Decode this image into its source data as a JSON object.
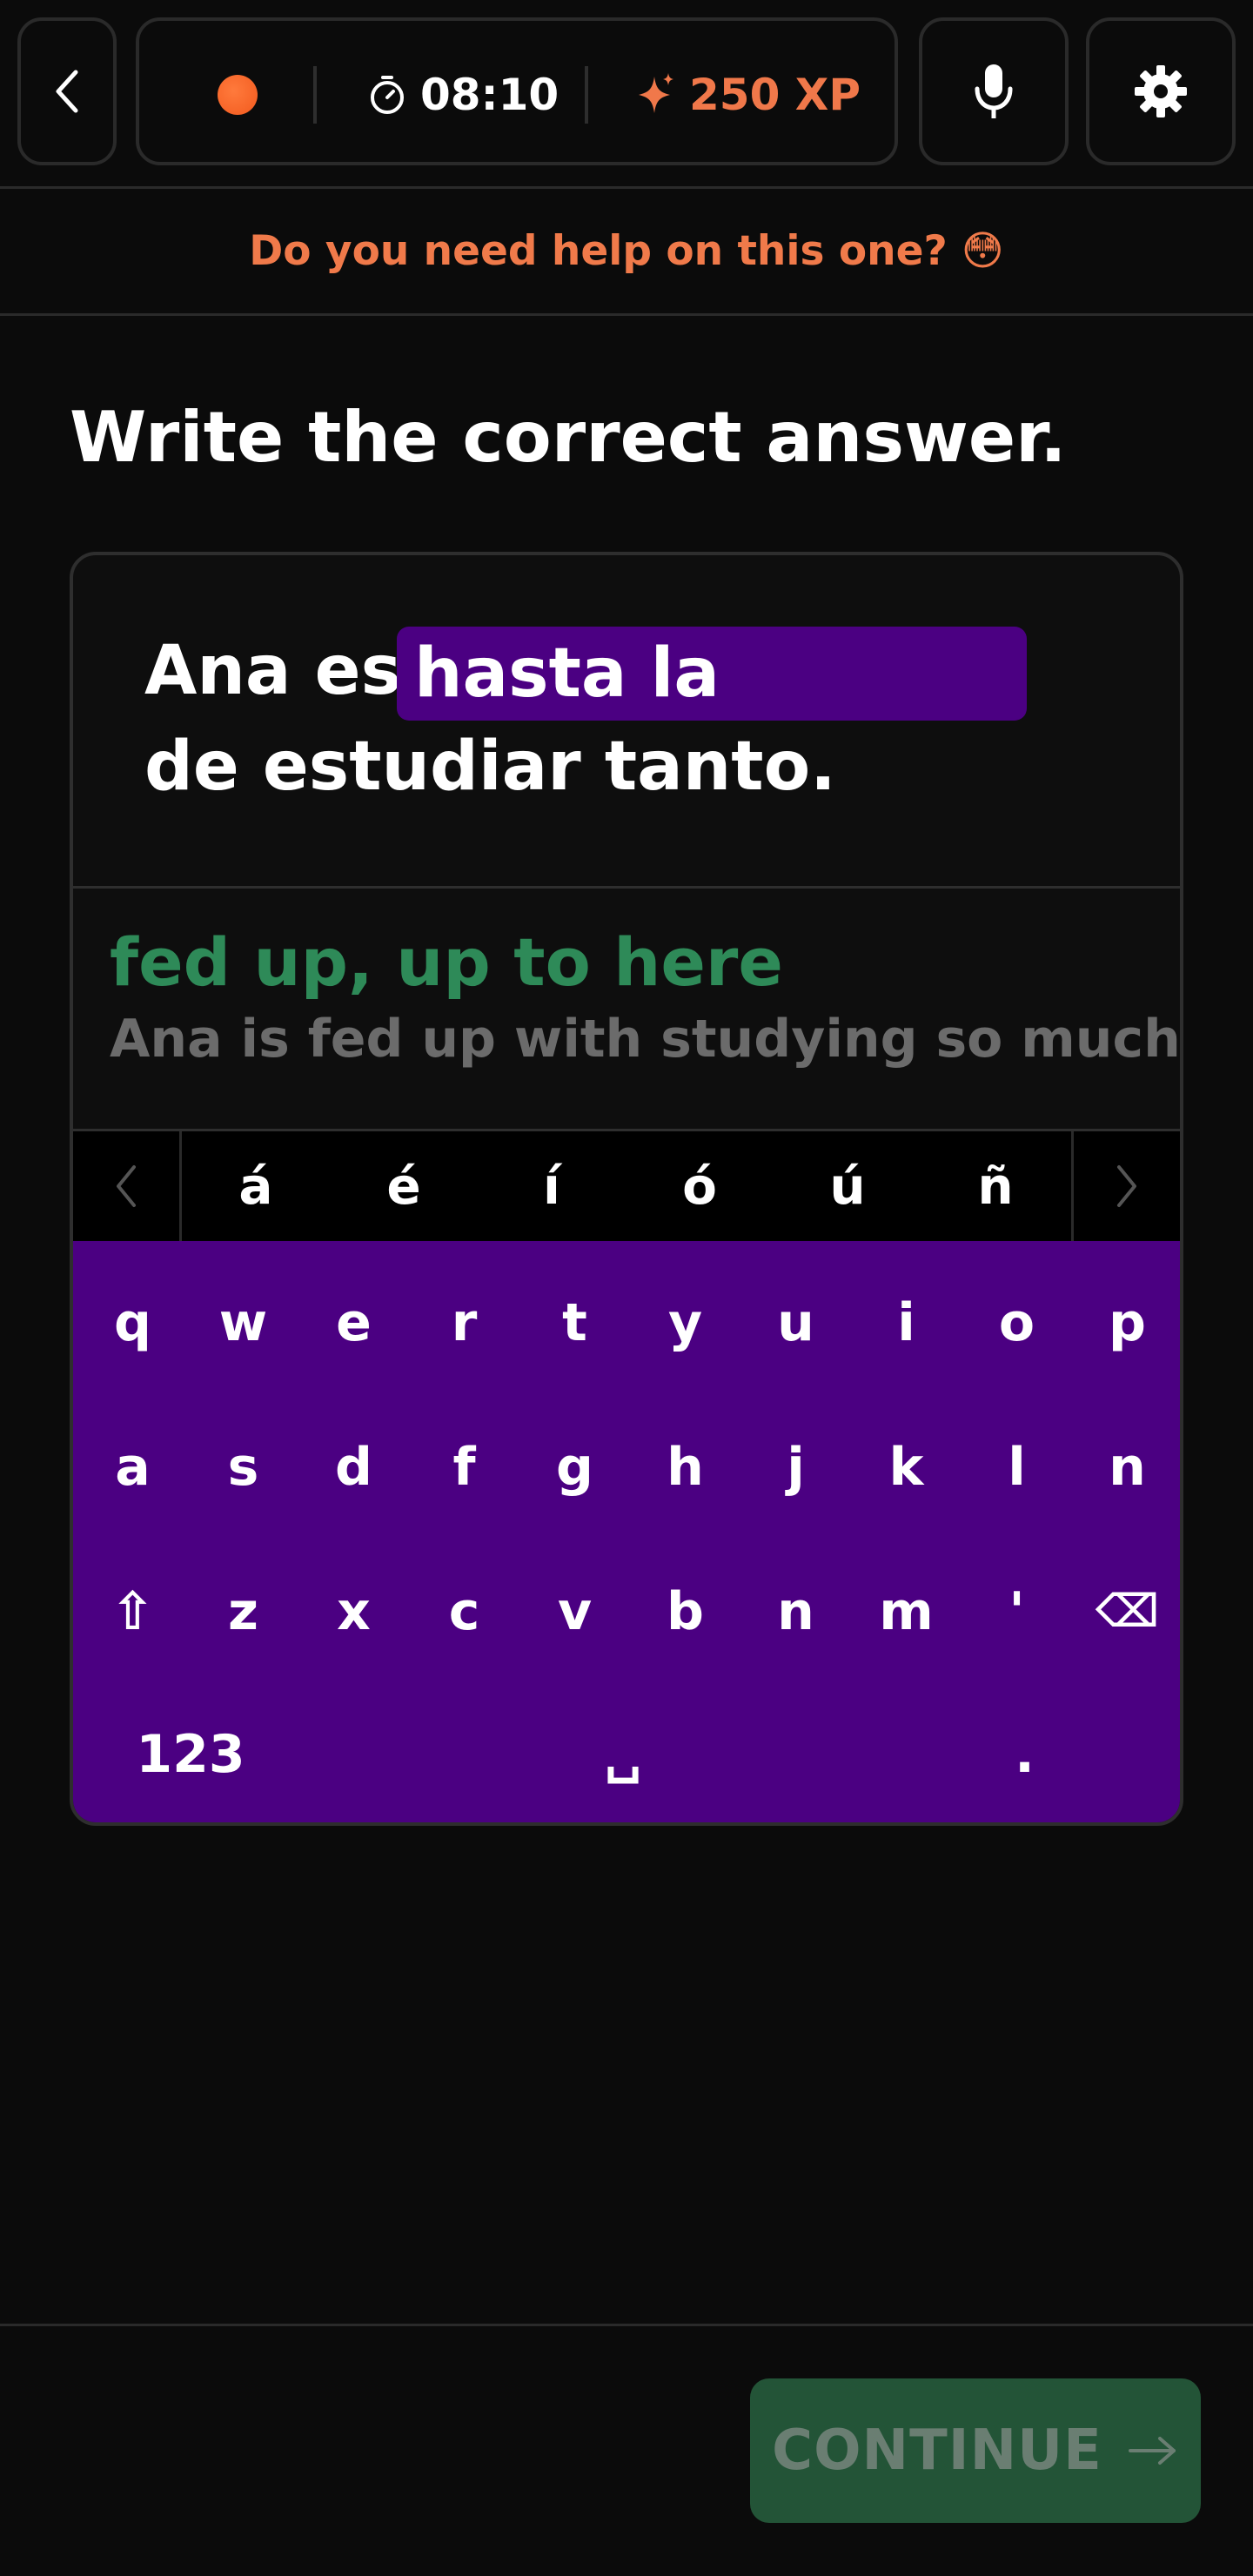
{
  "header": {
    "timer": "08:10",
    "xp": "250 XP",
    "icons": [
      "back-chevron-icon",
      "status-dot-icon",
      "stopwatch-icon",
      "sparkle-icon",
      "microphone-icon",
      "gear-icon"
    ],
    "status_color": "#f25a1e"
  },
  "help_text": "Do you need help on this one?",
  "help_emoji": "😳",
  "prompt": "Write the correct answer.",
  "exercise": {
    "before": "Ana está",
    "answer": "hasta la",
    "after": "de estudiar tanto."
  },
  "hint": {
    "meaning": "fed up, up to here",
    "translation": "Ana is fed up with studying so much."
  },
  "accents": [
    "á",
    "é",
    "í",
    "ó",
    "ú",
    "ñ"
  ],
  "keyboard": {
    "row1": [
      "q",
      "w",
      "e",
      "r",
      "t",
      "y",
      "u",
      "i",
      "o",
      "p"
    ],
    "row2": [
      "a",
      "s",
      "d",
      "f",
      "g",
      "h",
      "j",
      "k",
      "l",
      "n"
    ],
    "row3": [
      "⇧",
      "z",
      "x",
      "c",
      "v",
      "b",
      "n",
      "m",
      "'",
      "⌫"
    ],
    "numbers_label": "123",
    "space_label": "␣",
    "period_label": "."
  },
  "continue_label": "CONTINUE",
  "colors": {
    "accent_purple": "#4b0082",
    "xp_orange": "#f0784a",
    "hint_green": "#2e8a58",
    "continue_bg": "#235437"
  }
}
